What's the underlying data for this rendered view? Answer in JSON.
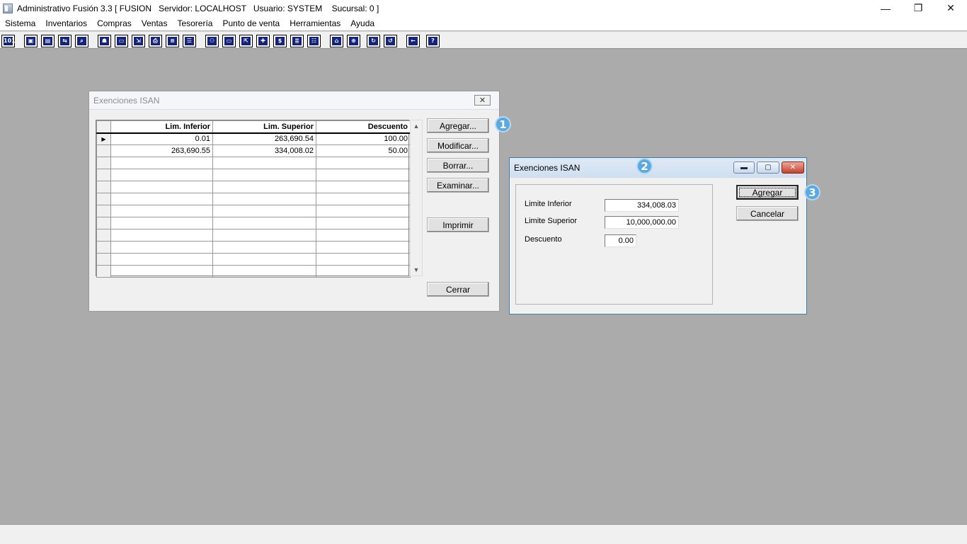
{
  "window": {
    "title": "Administrativo Fusión 3.3 [ FUSION   Servidor: LOCALHOST   Usuario: SYSTEM    Sucursal: 0 ]",
    "controls": {
      "minimize": "—",
      "restore": "❐",
      "close": "✕"
    }
  },
  "menu": {
    "items": [
      "Sistema",
      "Inventarios",
      "Compras",
      "Ventas",
      "Tesorería",
      "Punto de venta",
      "Herramientas",
      "Ayuda"
    ]
  },
  "toolbar": {
    "buttons": [
      {
        "icon": "calculator-icon",
        "glyph": "101"
      },
      {
        "icon": "window-icon",
        "glyph": "▣"
      },
      {
        "icon": "clipboard-icon",
        "glyph": "▤"
      },
      {
        "icon": "transfer-icon",
        "glyph": "⇆"
      },
      {
        "icon": "search-icon",
        "glyph": "⌕"
      },
      {
        "icon": "user-icon",
        "glyph": "☗"
      },
      {
        "icon": "folder-icon",
        "glyph": "▭"
      },
      {
        "icon": "import-icon",
        "glyph": "⇲"
      },
      {
        "icon": "printer-icon",
        "glyph": "⎙"
      },
      {
        "icon": "document-icon",
        "glyph": "≡"
      },
      {
        "icon": "list-icon",
        "glyph": "☰"
      },
      {
        "icon": "binoculars-icon",
        "glyph": "⚇"
      },
      {
        "icon": "box-icon",
        "glyph": "▭"
      },
      {
        "icon": "export-icon",
        "glyph": "⇱"
      },
      {
        "icon": "add-icon",
        "glyph": "✚"
      },
      {
        "icon": "dollar-icon",
        "glyph": "$"
      },
      {
        "icon": "report-icon",
        "glyph": "≣"
      },
      {
        "icon": "table-icon",
        "glyph": "☷"
      },
      {
        "icon": "home-icon",
        "glyph": "⌂"
      },
      {
        "icon": "zoom-icon",
        "glyph": "⊕"
      },
      {
        "icon": "refresh-icon",
        "glyph": "↻"
      },
      {
        "icon": "undo-icon",
        "glyph": "↺"
      },
      {
        "icon": "back-icon",
        "glyph": "←"
      },
      {
        "icon": "help-icon",
        "glyph": "?"
      }
    ]
  },
  "list_dialog": {
    "title": "Exenciones ISAN",
    "columns": [
      "Lim. Inferior",
      "Lim. Superior",
      "Descuento"
    ],
    "rows": [
      [
        "0.01",
        "263,690.54",
        "100.00"
      ],
      [
        "263,690.55",
        "334,008.02",
        "50.00"
      ],
      [
        "",
        "",
        ""
      ],
      [
        "",
        "",
        ""
      ],
      [
        "",
        "",
        ""
      ],
      [
        "",
        "",
        ""
      ],
      [
        "",
        "",
        ""
      ],
      [
        "",
        "",
        ""
      ],
      [
        "",
        "",
        ""
      ],
      [
        "",
        "",
        ""
      ],
      [
        "",
        "",
        ""
      ],
      [
        "",
        "",
        ""
      ]
    ],
    "current_row_marker": "▶",
    "buttons": {
      "agregar": "Agregar...",
      "modificar": "Modificar...",
      "borrar": "Borrar...",
      "examinar": "Examinar...",
      "imprimir": "Imprimir",
      "cerrar": "Cerrar"
    }
  },
  "edit_dialog": {
    "title": "Exenciones ISAN",
    "labels": {
      "limite_inferior": "Limite Inferior",
      "limite_superior": "Limite Superior",
      "descuento": "Descuento"
    },
    "values": {
      "limite_inferior": "334,008.03",
      "limite_superior": "10,000,000.00",
      "descuento": "0.00"
    },
    "buttons": {
      "agregar": "Agregar",
      "cancelar": "Cancelar"
    }
  },
  "badges": [
    "1",
    "2",
    "3"
  ],
  "colors": {
    "badge": "#5aa9e0",
    "toolbar_icon": "#15237a",
    "desktop": "#ababab"
  }
}
